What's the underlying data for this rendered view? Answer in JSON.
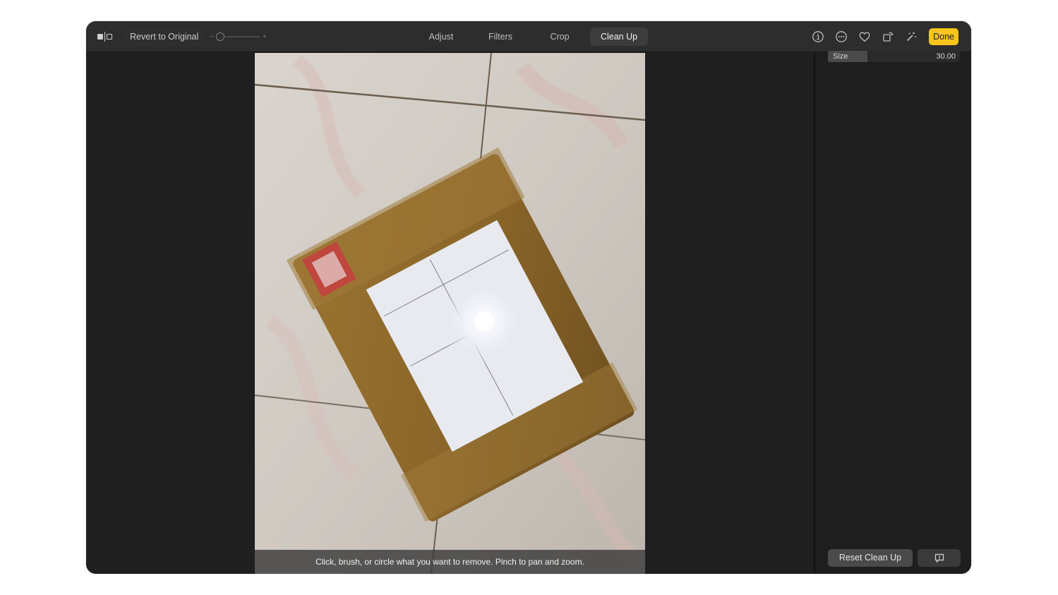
{
  "toolbar": {
    "compare_icon": "before-after-icon",
    "revert_label": "Revert to Original",
    "zoom_slider": {
      "minus": "−",
      "plus": "+",
      "value_fraction": 0.0
    },
    "tabs": [
      {
        "label": "Adjust",
        "active": false
      },
      {
        "label": "Filters",
        "active": false
      },
      {
        "label": "Crop",
        "active": false
      },
      {
        "label": "Clean Up",
        "active": true
      }
    ],
    "right_icons": [
      "info-icon",
      "more-icon",
      "heart-icon",
      "rotate-icon",
      "magic-wand-icon"
    ],
    "done_label": "Done",
    "accent_color": "#f7c51c"
  },
  "canvas": {
    "photo_description": "Brown taped package with white invoice label on marble tile floor",
    "hint_text": "Click, brush, or circle what you want to remove. Pinch to pan and zoom."
  },
  "sidebar": {
    "size_slider": {
      "label": "Size",
      "value": "30.00",
      "fill_fraction": 0.3
    },
    "reset_label": "Reset Clean Up",
    "feedback_icon": "feedback-icon"
  }
}
